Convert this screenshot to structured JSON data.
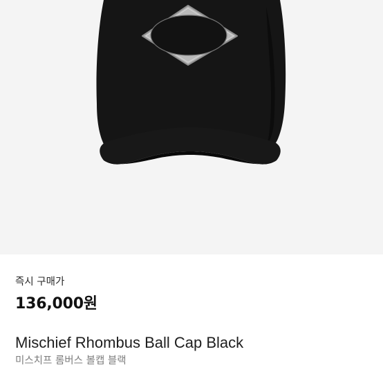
{
  "product": {
    "image_alt": "Mischief Rhombus Ball Cap Black",
    "image_background": "#f4f4f4",
    "cap_color": "#141414",
    "emblem_color": "#bcbcbc",
    "price_label": "즉시 구매가",
    "price": "136,000원",
    "title_en": "Mischief Rhombus Ball Cap Black",
    "title_ko": "미스치프 롬버스 볼캡 블랙"
  }
}
